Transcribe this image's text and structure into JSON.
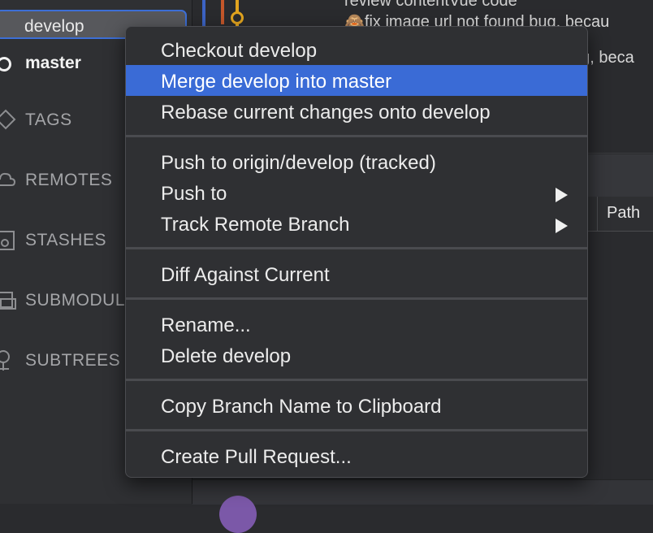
{
  "sidebar": {
    "branches": {
      "develop": "develop",
      "master": "master"
    },
    "sections": [
      {
        "label": "TAGS",
        "icon": "tag-icon"
      },
      {
        "label": "REMOTES",
        "icon": "cloud-icon"
      },
      {
        "label": "STASHES",
        "icon": "stash-icon"
      },
      {
        "label": "SUBMODUL",
        "icon": "submodule-icon"
      },
      {
        "label": "SUBTREES",
        "icon": "subtree-icon"
      }
    ]
  },
  "commits": {
    "top_text": "review contentVue code",
    "message_1": "🙈fix image url not found bug, becau",
    "message_2": "ug, beca"
  },
  "file_list": {
    "path_header": "Path"
  },
  "context_menu": {
    "items": [
      {
        "label": "Checkout develop"
      },
      {
        "label": "Merge develop into master",
        "highlighted": true
      },
      {
        "label": "Rebase current changes onto develop"
      },
      {
        "label": "Push to origin/develop (tracked)"
      },
      {
        "label": "Push to",
        "submenu": true
      },
      {
        "label": "Track Remote Branch",
        "submenu": true
      },
      {
        "label": "Diff Against Current"
      },
      {
        "label": "Rename..."
      },
      {
        "label": "Delete develop"
      },
      {
        "label": "Copy Branch Name to Clipboard"
      },
      {
        "label": "Create Pull Request..."
      }
    ]
  },
  "colors": {
    "highlight": "#3a6bd6",
    "menu_bg": "#2f3033",
    "graph_orange": "#e3a51f",
    "graph_blue": "#3c63c4"
  }
}
